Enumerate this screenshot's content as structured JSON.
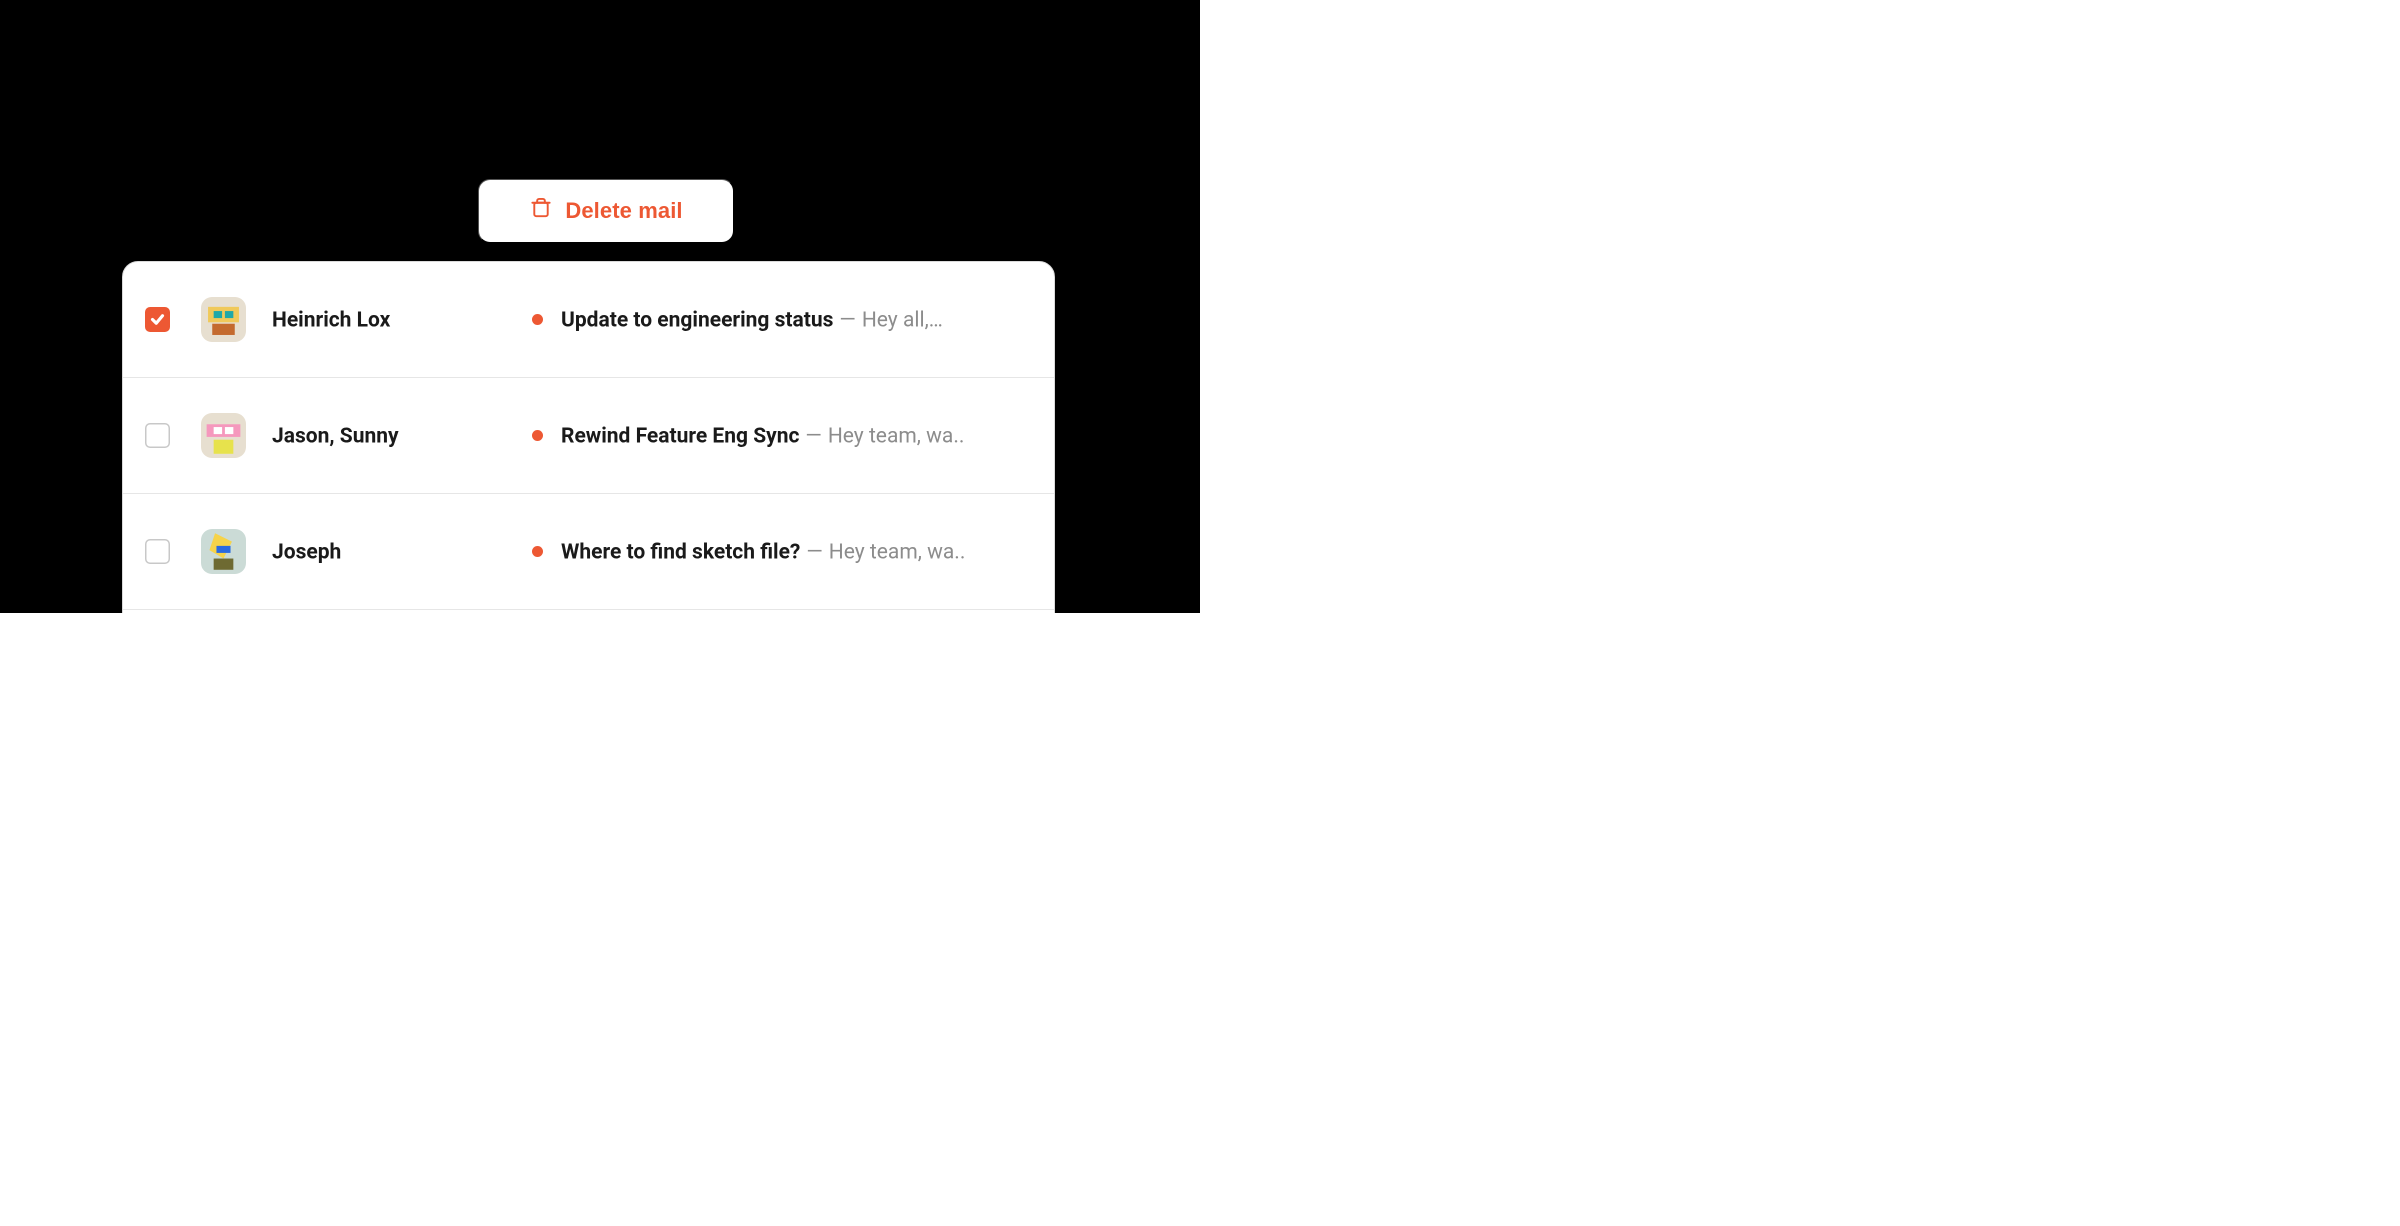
{
  "action_bar": {
    "delete_label": "Delete mail"
  },
  "colors": {
    "accent": "#ED5833",
    "text": "#1A1A1A",
    "muted": "#8C8C8C"
  },
  "mail_list": {
    "items": [
      {
        "selected": true,
        "unread": true,
        "sender": "Heinrich Lox",
        "subject": "Update to engineering status",
        "preview": "Hey all,…"
      },
      {
        "selected": false,
        "unread": true,
        "sender": "Jason, Sunny",
        "subject": "Rewind Feature Eng Sync",
        "preview": "Hey team, wa.."
      },
      {
        "selected": false,
        "unread": true,
        "sender": "Joseph",
        "subject": "Where to find sketch file?",
        "preview": "Hey team, wa.."
      }
    ]
  }
}
